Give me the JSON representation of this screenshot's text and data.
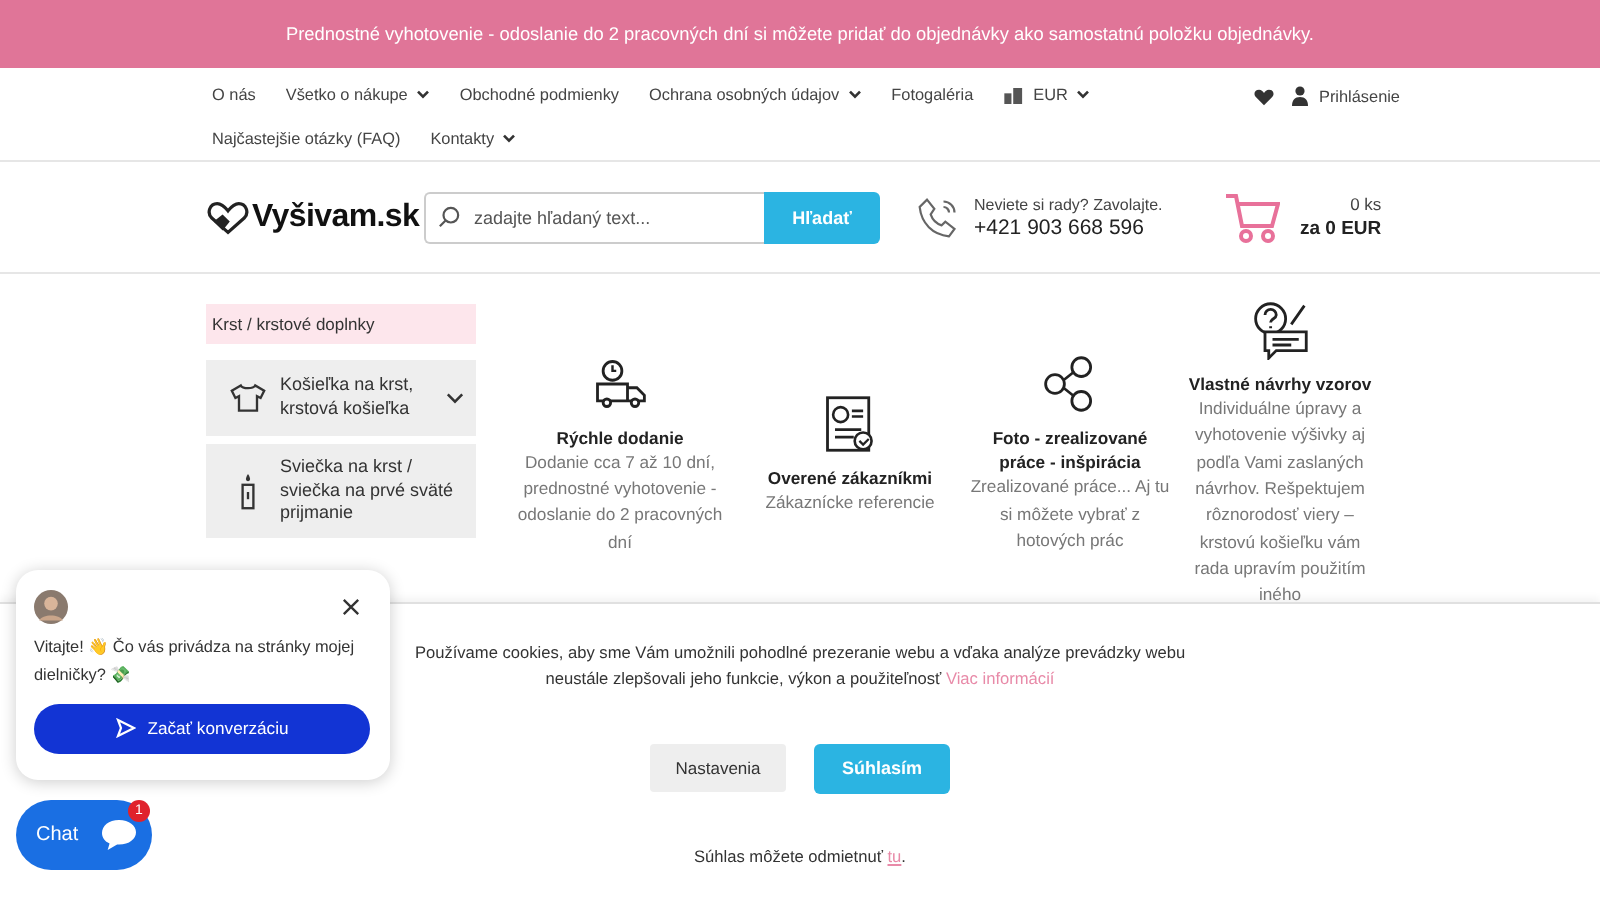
{
  "announcement": "Prednostné vyhotovenie - odoslanie do 2 pracovných dní si môžete pridať do objednávky ako samostatnú položku objednávky.",
  "nav_rows": [
    {
      "items": [
        {
          "kind": "link",
          "label": "O nás",
          "dropdown": false
        },
        {
          "kind": "link",
          "label": "Všetko o nákupe",
          "dropdown": true
        },
        {
          "kind": "link",
          "label": "Obchodné podmienky",
          "dropdown": false
        },
        {
          "kind": "link",
          "label": "Ochrana osobných údajov",
          "dropdown": true
        },
        {
          "kind": "link",
          "label": "Fotogaléria",
          "dropdown": false
        },
        {
          "kind": "currency",
          "label": "EUR",
          "dropdown": true
        }
      ]
    },
    {
      "items": [
        {
          "kind": "link",
          "label": "Najčastejšie otázky (FAQ)",
          "dropdown": false
        },
        {
          "kind": "link",
          "label": "Kontakty",
          "dropdown": true
        }
      ]
    }
  ],
  "login": "Prihlásenie",
  "header": {
    "logo": "Vyšivam.sk",
    "search": {
      "placeholder": "zadajte hľadaný text...",
      "button": "Hľadať"
    },
    "phone_prompt": "Neviete si rady? Zavolajte.",
    "phone": "+421 903 668 596",
    "cart_count": "0 ks",
    "cart_total": "za 0 EUR"
  },
  "sidebar": {
    "title": "Krst / krstové doplnky",
    "items": [
      {
        "label": "Košieľka na krst, krstová košieľka",
        "expandable": true
      },
      {
        "label": "Sviečka na krst / sviečka na prvé sväté prijmanie",
        "expandable": false
      }
    ]
  },
  "features": [
    {
      "title": "Rýchle dodanie",
      "text": "Dodanie cca 7 až 10 dní, prednostné vyhotovenie - odoslanie do 2 pracovných dní"
    },
    {
      "title": "Overené zákazníkmi",
      "text": "Zákaznícke referencie"
    },
    {
      "title": "Foto - zrealizované práce - inšpirácia",
      "text": "Zrealizované práce... Aj tu si môžete vybrať z hotových prác"
    },
    {
      "title": "Vlastné návrhy vzorov",
      "text": "Individuálne úpravy a vyhotovenie výšivky aj podľa Vami zaslaných návrhov. Rešpektujem rôznorodosť viery – krstovú košieľku vám rada upravím použitím iného"
    }
  ],
  "cookies": {
    "text": "Používame cookies, aby sme Vám umožnili pohodlné prezeranie webu a vďaka analýze prevádzky webu neustále zlepšovali jeho funkcie, výkon a použiteľnosť",
    "link": "Viac informácií",
    "buttons": [
      "Nastavenia",
      "Súhlasím"
    ],
    "refuse_text": "Súhlas môžete odmietnuť",
    "refuse_link": "tu",
    "refuse_end": "."
  },
  "chat": {
    "greeting": "Vitajte! 👋 Čo vás privádza na stránky mojej dielničky? 💸",
    "start_button": "Začať konverzáciu",
    "launcher": "Chat",
    "badge": "1"
  }
}
